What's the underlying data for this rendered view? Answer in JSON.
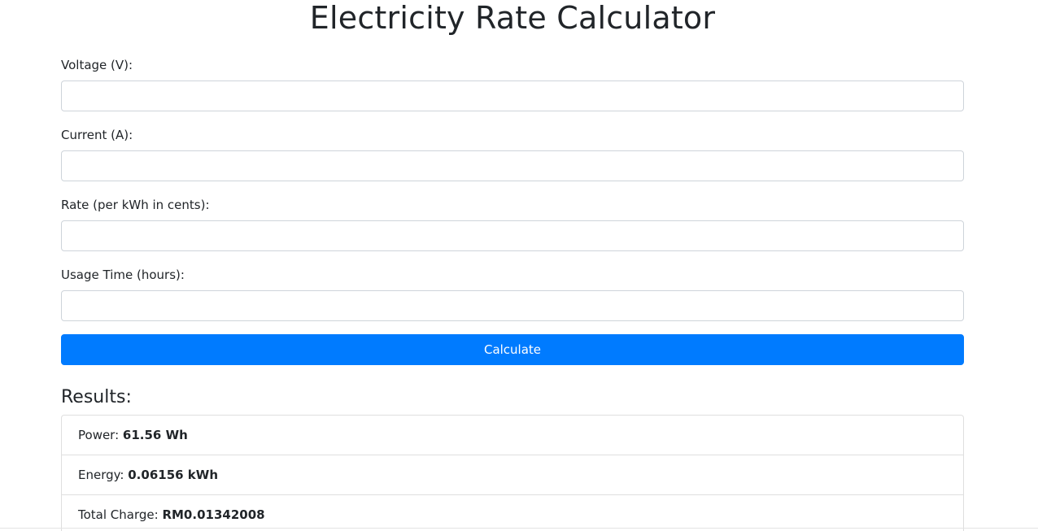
{
  "page": {
    "title": "Electricity Rate Calculator"
  },
  "form": {
    "fields": [
      {
        "label": "Voltage (V):",
        "value": "",
        "placeholder": ""
      },
      {
        "label": "Current (A):",
        "value": "",
        "placeholder": ""
      },
      {
        "label": "Rate (per kWh in cents):",
        "value": "",
        "placeholder": ""
      },
      {
        "label": "Usage Time (hours):",
        "value": "",
        "placeholder": ""
      }
    ],
    "submit_label": "Calculate"
  },
  "results": {
    "heading": "Results:",
    "items": [
      {
        "label": "Power: ",
        "value": "61.56 Wh"
      },
      {
        "label": "Energy: ",
        "value": "0.06156 kWh"
      },
      {
        "label": "Total Charge: ",
        "value": "RM0.01342008"
      }
    ]
  },
  "colors": {
    "accent": "#007bff",
    "text": "#212529",
    "border": "#ced4da"
  }
}
